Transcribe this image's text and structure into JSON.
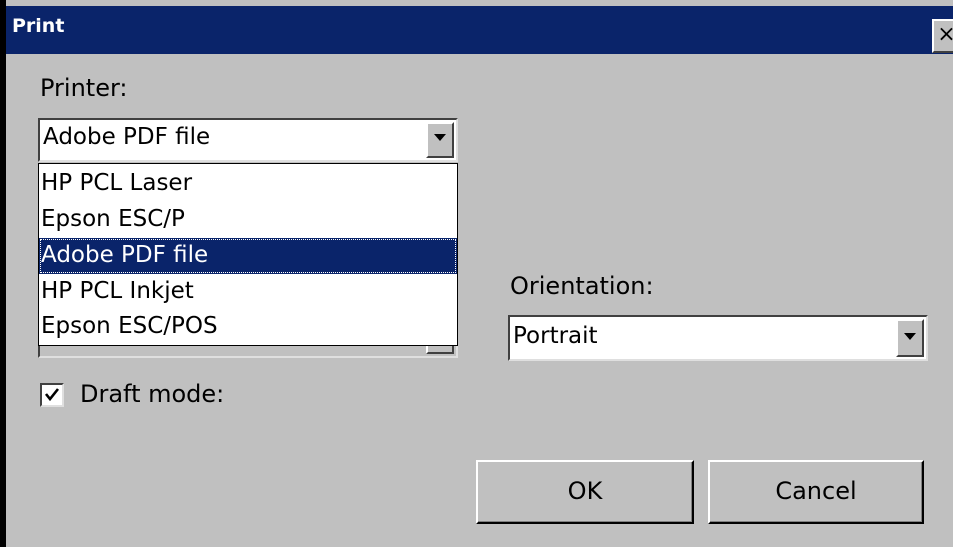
{
  "window": {
    "title": "Print",
    "close_glyph": "×"
  },
  "printer": {
    "label": "Printer:",
    "selected": "Adobe PDF file",
    "options": [
      "HP PCL Laser",
      "Epson ESC/P",
      "Adobe PDF file",
      "HP PCL Inkjet",
      "Epson ESC/POS"
    ],
    "highlighted_index": 2
  },
  "orientation": {
    "label": "Orientation:",
    "selected": "Portrait"
  },
  "draft_mode": {
    "label": "Draft mode:",
    "checked": true
  },
  "buttons": {
    "ok": "OK",
    "cancel": "Cancel"
  },
  "colors": {
    "titlebar": "#0a246a",
    "face": "#c0c0c0",
    "highlight": "#0a246a"
  }
}
